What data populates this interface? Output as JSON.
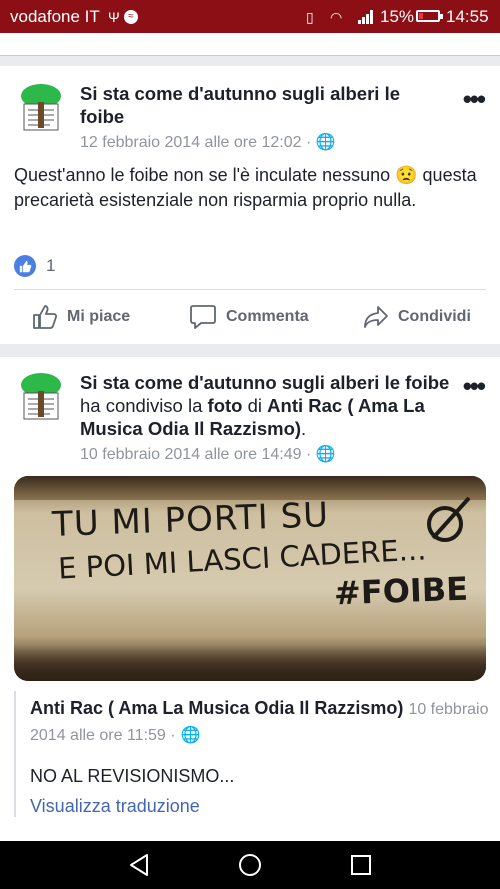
{
  "status_bar": {
    "carrier": "vodafone IT",
    "battery_pct": "15%",
    "time": "14:55",
    "battery_level": 0.15
  },
  "post1": {
    "page_name": "Si sta come d'autunno sugli alberi le foibe",
    "timestamp": "12 febbraio 2014 alle ore 12:02 ·",
    "text": "Quest'anno le foibe non se l'è inculate nessuno 😟 questa precarietà esistenziale non risparmia proprio nulla.",
    "like_count": "1",
    "actions": {
      "like": "Mi piace",
      "comment": "Commenta",
      "share": "Condividi"
    }
  },
  "post2": {
    "page_name": "Si sta come d'autunno sugli alberi le foibe",
    "shared_text_1": "ha condiviso la",
    "shared_word": "foto",
    "shared_text_2": "di",
    "shared_target": "Anti Rac ( Ama La Musica Odia Il Razzismo)",
    "shared_end": ".",
    "timestamp": "10 febbraio 2014 alle ore 14:49 ·",
    "photo": {
      "line1": "TU MI PORTI SU",
      "line2": "E POI MI LASCI CADERE...",
      "tag": "#FOIBE"
    },
    "original": {
      "author": "Anti Rac ( Ama La Musica Odia Il Razzismo)",
      "timestamp": "10 febbraio 2014 alle ore 11:59 ·",
      "text": "NO AL REVISIONISMO...",
      "translate": "Visualizza traduzione"
    }
  },
  "colors": {
    "status_bar": "#8b0f14",
    "link_blue": "#4267b2",
    "background": "#e9ebee"
  }
}
